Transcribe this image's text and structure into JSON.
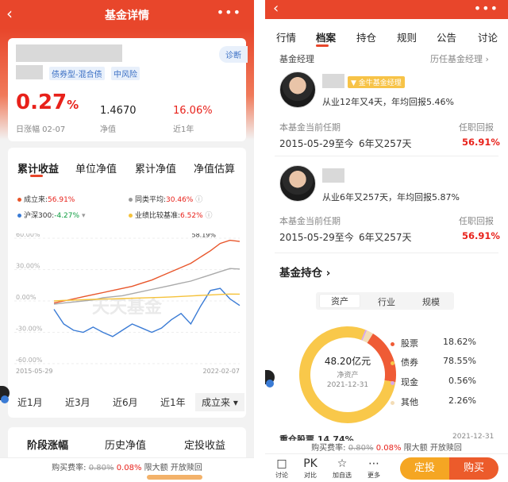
{
  "left": {
    "header": {
      "back": "‹",
      "title": "基金详情",
      "more": "•••"
    },
    "fund": {
      "tags": [
        "债券型-混合债",
        "中风险"
      ],
      "diagnose": "诊断",
      "day_change": "0.27",
      "day_change_unit": "%",
      "day_label": "日涨幅 02-07",
      "nav": "1.4670",
      "nav_label": "净值",
      "year_return": "16.06%",
      "year_label": "近1年"
    },
    "chart_tabs": [
      "累计收益",
      "单位净值",
      "累计净值",
      "净值估算"
    ],
    "legend": [
      {
        "label": "成立来:",
        "value": "56.91%",
        "color": "#e8562b"
      },
      {
        "label": "同类平均:",
        "value": "30.46%",
        "color": "#9b9b9b"
      },
      {
        "label": "沪深300:",
        "value": "-4.27%",
        "color": "#3a7bd5"
      },
      {
        "label": "业绩比较基准:",
        "value": "6.52%",
        "color": "#f5c23b"
      }
    ],
    "period_tabs": [
      "近1月",
      "近3月",
      "近6月",
      "近1年",
      "成立来 ▾"
    ],
    "bottom_tabs": [
      "阶段涨幅",
      "历史净值",
      "定投收益"
    ],
    "fee": {
      "label": "购买费率:",
      "old": "0.80%",
      "new": "0.08%",
      "tags": "限大额  开放赎回"
    }
  },
  "chart_data": {
    "type": "line",
    "x_start": "2015-05-29",
    "x_end": "2022-02-07",
    "ylim": [
      -60,
      60
    ],
    "yticks": [
      "60.00%",
      "30.00%",
      "0.00%",
      "-30.00%",
      "-60.00%"
    ],
    "annotation": "58.19%",
    "series": [
      {
        "name": "成立来",
        "color": "#e8562b",
        "values": [
          -2,
          0,
          2,
          4,
          6,
          8,
          10,
          12,
          14,
          17,
          20,
          24,
          28,
          32,
          36,
          42,
          48,
          55,
          58,
          56.9
        ]
      },
      {
        "name": "同类平均",
        "color": "#aaaaaa",
        "values": [
          -3,
          -2,
          -1,
          0,
          1,
          3,
          4,
          5,
          7,
          9,
          11,
          13,
          15,
          17,
          19,
          22,
          25,
          28,
          31,
          30.5
        ]
      },
      {
        "name": "沪深300",
        "color": "#3a7bd5",
        "values": [
          -8,
          -22,
          -28,
          -30,
          -25,
          -30,
          -34,
          -28,
          -22,
          -26,
          -30,
          -26,
          -18,
          -12,
          -22,
          -5,
          10,
          12,
          2,
          -4.3
        ]
      },
      {
        "name": "业绩比较基准",
        "color": "#f5c23b",
        "values": [
          0,
          0.5,
          0.8,
          1.2,
          1.5,
          1.8,
          2,
          2.3,
          2.6,
          2.9,
          3.2,
          3.5,
          3.9,
          4.3,
          4.8,
          5.3,
          5.8,
          6.2,
          6.6,
          6.5
        ]
      }
    ],
    "watermark": "天天基金"
  },
  "right": {
    "header": {
      "back": "‹",
      "more": "•••"
    },
    "tabs": [
      "行情",
      "档案",
      "持仓",
      "规则",
      "公告",
      "讨论"
    ],
    "manager_title": "基金经理",
    "manager_history": "历任基金经理 ›",
    "managers": [
      {
        "badge": "金牛基金经理",
        "desc": "从业12年又4天，年均回报5.46%",
        "term_label": "本基金当前任期",
        "return_label": "任职回报",
        "term": "2015-05-29至今",
        "duration": "6年又257天",
        "return": "56.91%"
      },
      {
        "badge": "",
        "desc": "从业6年又257天，年均回报5.87%",
        "term_label": "本基金当前任期",
        "return_label": "任职回报",
        "term": "2015-05-29至今",
        "duration": "6年又257天",
        "return": "56.91%"
      }
    ],
    "holdings_title": "基金持仓 ›",
    "holdings_tabs": [
      "资产",
      "行业",
      "规模"
    ],
    "donut_center": {
      "value": "48.20亿元",
      "label": "净资产",
      "date": "2021-12-31"
    },
    "allocation": [
      {
        "name": "股票",
        "value": "18.62%",
        "color": "#ef5b35",
        "pct": 18.62
      },
      {
        "name": "债券",
        "value": "78.55%",
        "color": "#f9c84a",
        "pct": 78.55
      },
      {
        "name": "现金",
        "value": "0.56%",
        "color": "#d7a7e8",
        "pct": 0.56
      },
      {
        "name": "其他",
        "value": "2.26%",
        "color": "#f3dcb6",
        "pct": 2.26
      }
    ],
    "cut_text": "重仓股票  14.74%",
    "cut_date": "2021-12-31",
    "fee": {
      "label": "购买费率:",
      "old": "0.80%",
      "new": "0.08%",
      "tags": "限大额  开放赎回"
    },
    "bottom": {
      "items": [
        {
          "icon": "□",
          "label": "讨论"
        },
        {
          "icon": "PK",
          "label": "对比"
        },
        {
          "icon": "☆",
          "label": "加自选"
        },
        {
          "icon": "⋯",
          "label": "更多"
        }
      ],
      "invest": "定投",
      "buy": "购买"
    }
  }
}
